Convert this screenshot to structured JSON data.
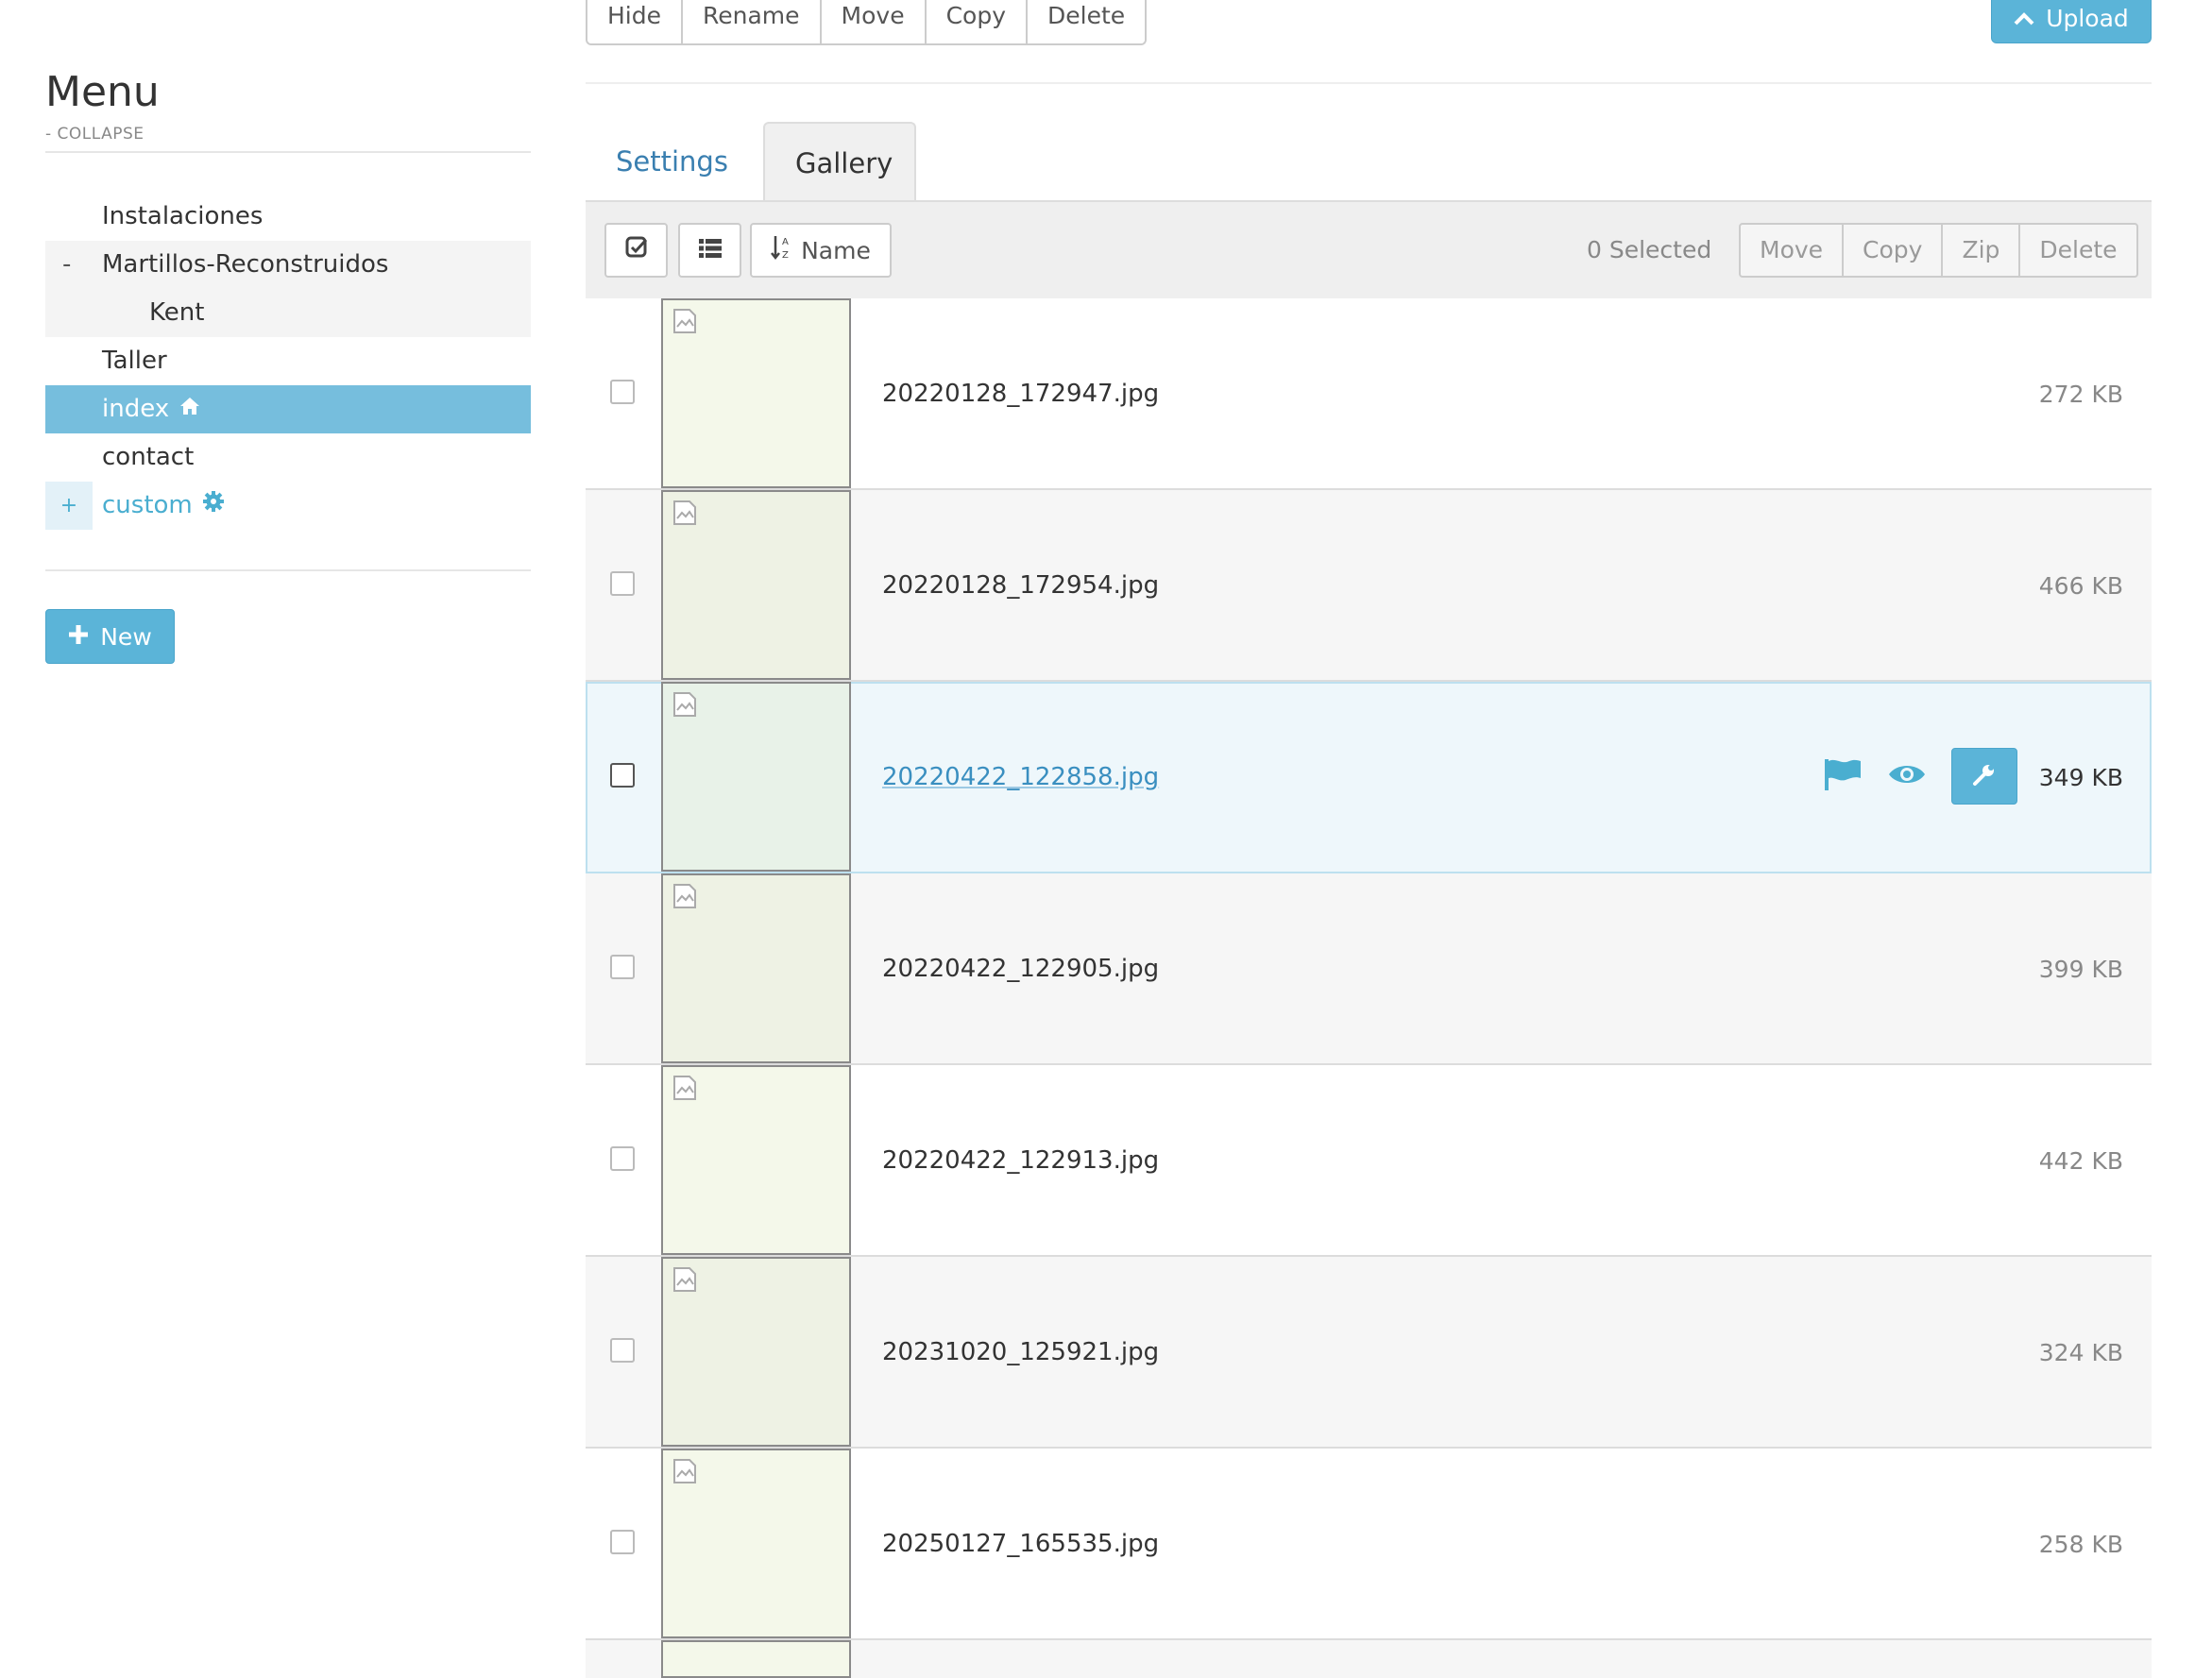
{
  "sidebar": {
    "title": "Menu",
    "collapse_label": "- COLLAPSE",
    "items": [
      {
        "label": "Instalaciones"
      },
      {
        "label": "Martillos-Reconstruidos",
        "prefix": "-"
      },
      {
        "label": "Kent"
      },
      {
        "label": "Taller"
      },
      {
        "label": "index",
        "icon": "home-icon"
      },
      {
        "label": "contact"
      },
      {
        "label": "custom",
        "prefix": "+",
        "icon": "gear-icon"
      }
    ],
    "new_button": "New"
  },
  "top_toolbar": {
    "buttons": [
      "Hide",
      "Rename",
      "Move",
      "Copy",
      "Delete"
    ],
    "upload": "Upload"
  },
  "tabs": [
    {
      "label": "Settings",
      "active": false
    },
    {
      "label": "Gallery",
      "active": true
    }
  ],
  "gallery_toolbar": {
    "sort_label": "Name",
    "selected_count": "0 Selected",
    "actions": [
      "Move",
      "Copy",
      "Zip",
      "Delete"
    ]
  },
  "files": [
    {
      "name": "20220128_172947.jpg",
      "size": "272 KB",
      "thumb_color": "#f4f8ea"
    },
    {
      "name": "20220128_172954.jpg",
      "size": "466 KB",
      "thumb_color": "#eef2e4"
    },
    {
      "name": "20220422_122858.jpg",
      "size": "349 KB",
      "thumb_color": "#e8f2e8"
    },
    {
      "name": "20220422_122905.jpg",
      "size": "399 KB",
      "thumb_color": "#eef2e4"
    },
    {
      "name": "20220422_122913.jpg",
      "size": "442 KB",
      "thumb_color": "#f4f8ea"
    },
    {
      "name": "20231020_125921.jpg",
      "size": "324 KB",
      "thumb_color": "#eef2e4"
    },
    {
      "name": "20250127_165535.jpg",
      "size": "258 KB",
      "thumb_color": "#f4f8ea"
    }
  ],
  "colors": {
    "accent": "#5bb4d8",
    "active_menu": "#76bedd",
    "link": "#3a7fb0"
  }
}
